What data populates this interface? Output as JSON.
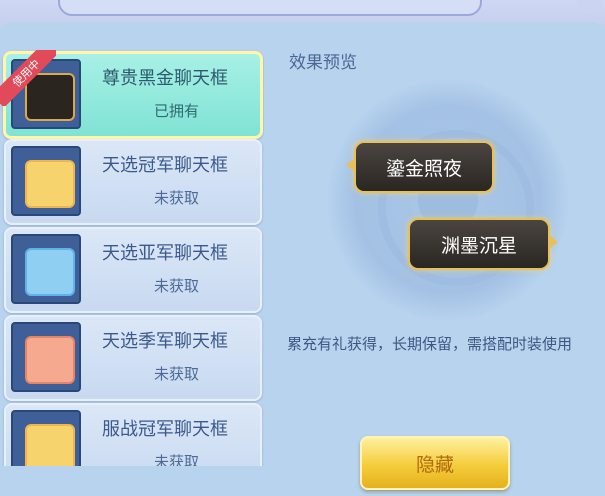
{
  "frame_list": [
    {
      "name": "尊贵黑金聊天框",
      "status": "已拥有",
      "in_use_label": "使用中",
      "selected": true,
      "bubble_color": "#2b2520"
    },
    {
      "name": "天选冠军聊天框",
      "status": "未获取",
      "selected": false,
      "bubble_color": "#f7d36d"
    },
    {
      "name": "天选亚军聊天框",
      "status": "未获取",
      "selected": false,
      "bubble_color": "#8fcff2"
    },
    {
      "name": "天选季军聊天框",
      "status": "未获取",
      "selected": false,
      "bubble_color": "#f5aa90"
    },
    {
      "name": "服战冠军聊天框",
      "status": "未获取",
      "selected": false,
      "bubble_color": "#f7d36d"
    }
  ],
  "preview": {
    "title": "效果预览",
    "bubble_1_text": "鎏金照夜",
    "bubble_2_text": "渊墨沉星"
  },
  "description": "累充有礼获得，长期保留，需搭配时装使用",
  "hide_button_label": "隐藏"
}
